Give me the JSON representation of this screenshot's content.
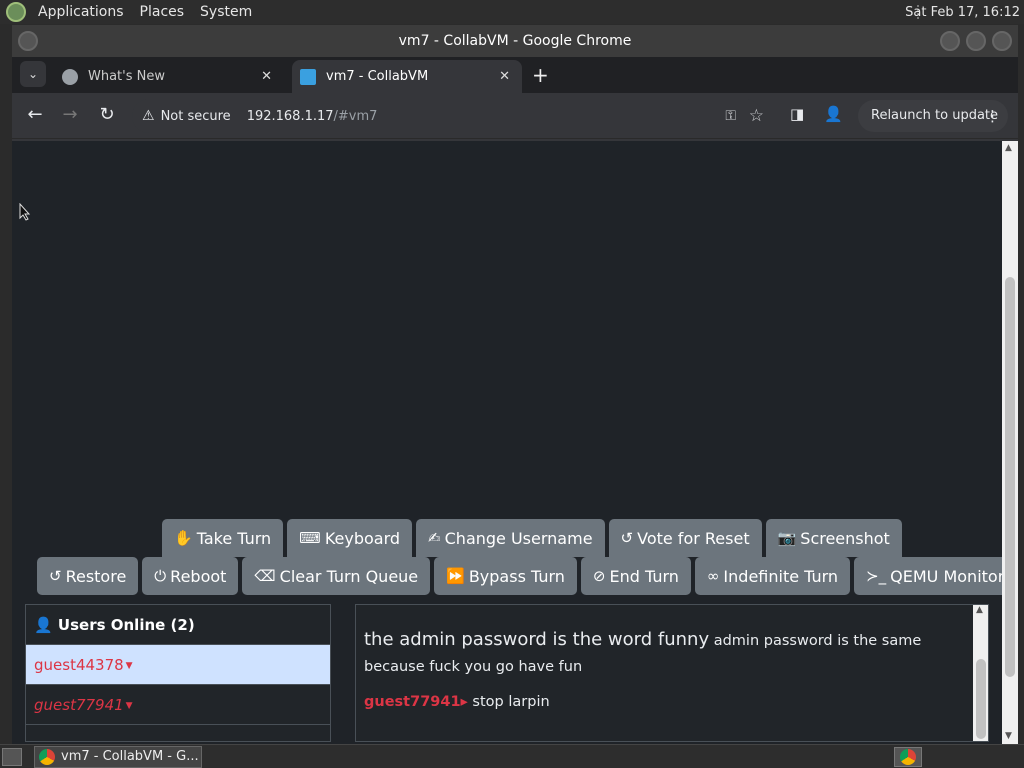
{
  "desktop": {
    "menus": [
      "Applications",
      "Places",
      "System"
    ],
    "clock": "Sat Feb 17, 16:12"
  },
  "window": {
    "title": "vm7 - CollabVM - Google Chrome"
  },
  "tabs": [
    {
      "label": "What's New",
      "close": "✕"
    },
    {
      "label": "vm7 - CollabVM",
      "close": "✕"
    }
  ],
  "toolbar": {
    "security_label": "Not secure",
    "url_host": "192.168.1.17",
    "url_path": "/#vm7",
    "relaunch_label": "Relaunch to update"
  },
  "buttons_row1": [
    {
      "icon": "hand-icon",
      "glyph": "✋",
      "label": "Take Turn"
    },
    {
      "icon": "keyboard-icon",
      "glyph": "⌨",
      "label": "Keyboard"
    },
    {
      "icon": "signature-icon",
      "glyph": "✍",
      "label": "Change Username"
    },
    {
      "icon": "undo-icon",
      "glyph": "↺",
      "label": "Vote for Reset"
    },
    {
      "icon": "camera-icon",
      "glyph": "📷",
      "label": "Screenshot"
    }
  ],
  "buttons_row2": [
    {
      "icon": "undo-icon",
      "glyph": "↺",
      "label": "Restore"
    },
    {
      "icon": "power-icon",
      "glyph": "⏻",
      "label": "Reboot"
    },
    {
      "icon": "eraser-icon",
      "glyph": "⌫",
      "label": "Clear Turn Queue"
    },
    {
      "icon": "forward-icon",
      "glyph": "⏩",
      "label": "Bypass Turn"
    },
    {
      "icon": "ban-icon",
      "glyph": "⊘",
      "label": "End Turn"
    },
    {
      "icon": "infinity-icon",
      "glyph": "∞",
      "label": "Indefinite Turn"
    },
    {
      "icon": "terminal-icon",
      "glyph": "≻_",
      "label": "QEMU Monitor"
    }
  ],
  "users": {
    "header": "Users Online (2)",
    "list": [
      "guest44378",
      "guest77941"
    ]
  },
  "chat": {
    "messages": [
      {
        "big": "the admin password is the word funny",
        "text": " admin password is the same because fuck you go have fun"
      },
      {
        "user": "guest77941▸",
        "text": " stop larpin"
      }
    ]
  },
  "taskbar": {
    "task_label": "vm7 - CollabVM - G..."
  },
  "colors": {
    "page_bg": "#1f2328",
    "button_bg": "#6c757d",
    "username_red": "#dc3545",
    "selected_user_bg": "#cfe2ff"
  }
}
